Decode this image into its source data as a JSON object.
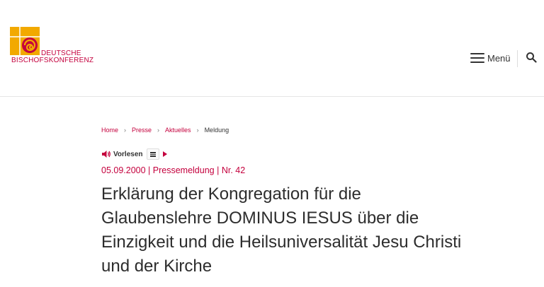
{
  "logo": {
    "line1": "DEUTSCHE",
    "line2": "BISCHOFSKONFERENZ",
    "brand_color": "#c4003d",
    "accent_color": "#f2a900"
  },
  "header": {
    "menu_label": "Menü",
    "menu_icon": "hamburger-icon",
    "search_icon": "search-icon"
  },
  "breadcrumb": {
    "items": [
      "Home",
      "Presse",
      "Aktuelles"
    ],
    "current": "Meldung",
    "separator": "›"
  },
  "readspeaker": {
    "label": "Vorlesen",
    "speaker_icon": "speaker-icon",
    "menu_icon": "menu-icon",
    "play_icon": "play-icon"
  },
  "article": {
    "date": "05.09.2000",
    "type": "Pressemeldung",
    "number": "Nr. 42",
    "meta_sep": " | ",
    "title": "Erklärung der Kongregation für die Glaubenslehre DOMINUS IESUS über die Einzigkeit und die Heilsuniversalität Jesu Christi und der Kirche"
  }
}
